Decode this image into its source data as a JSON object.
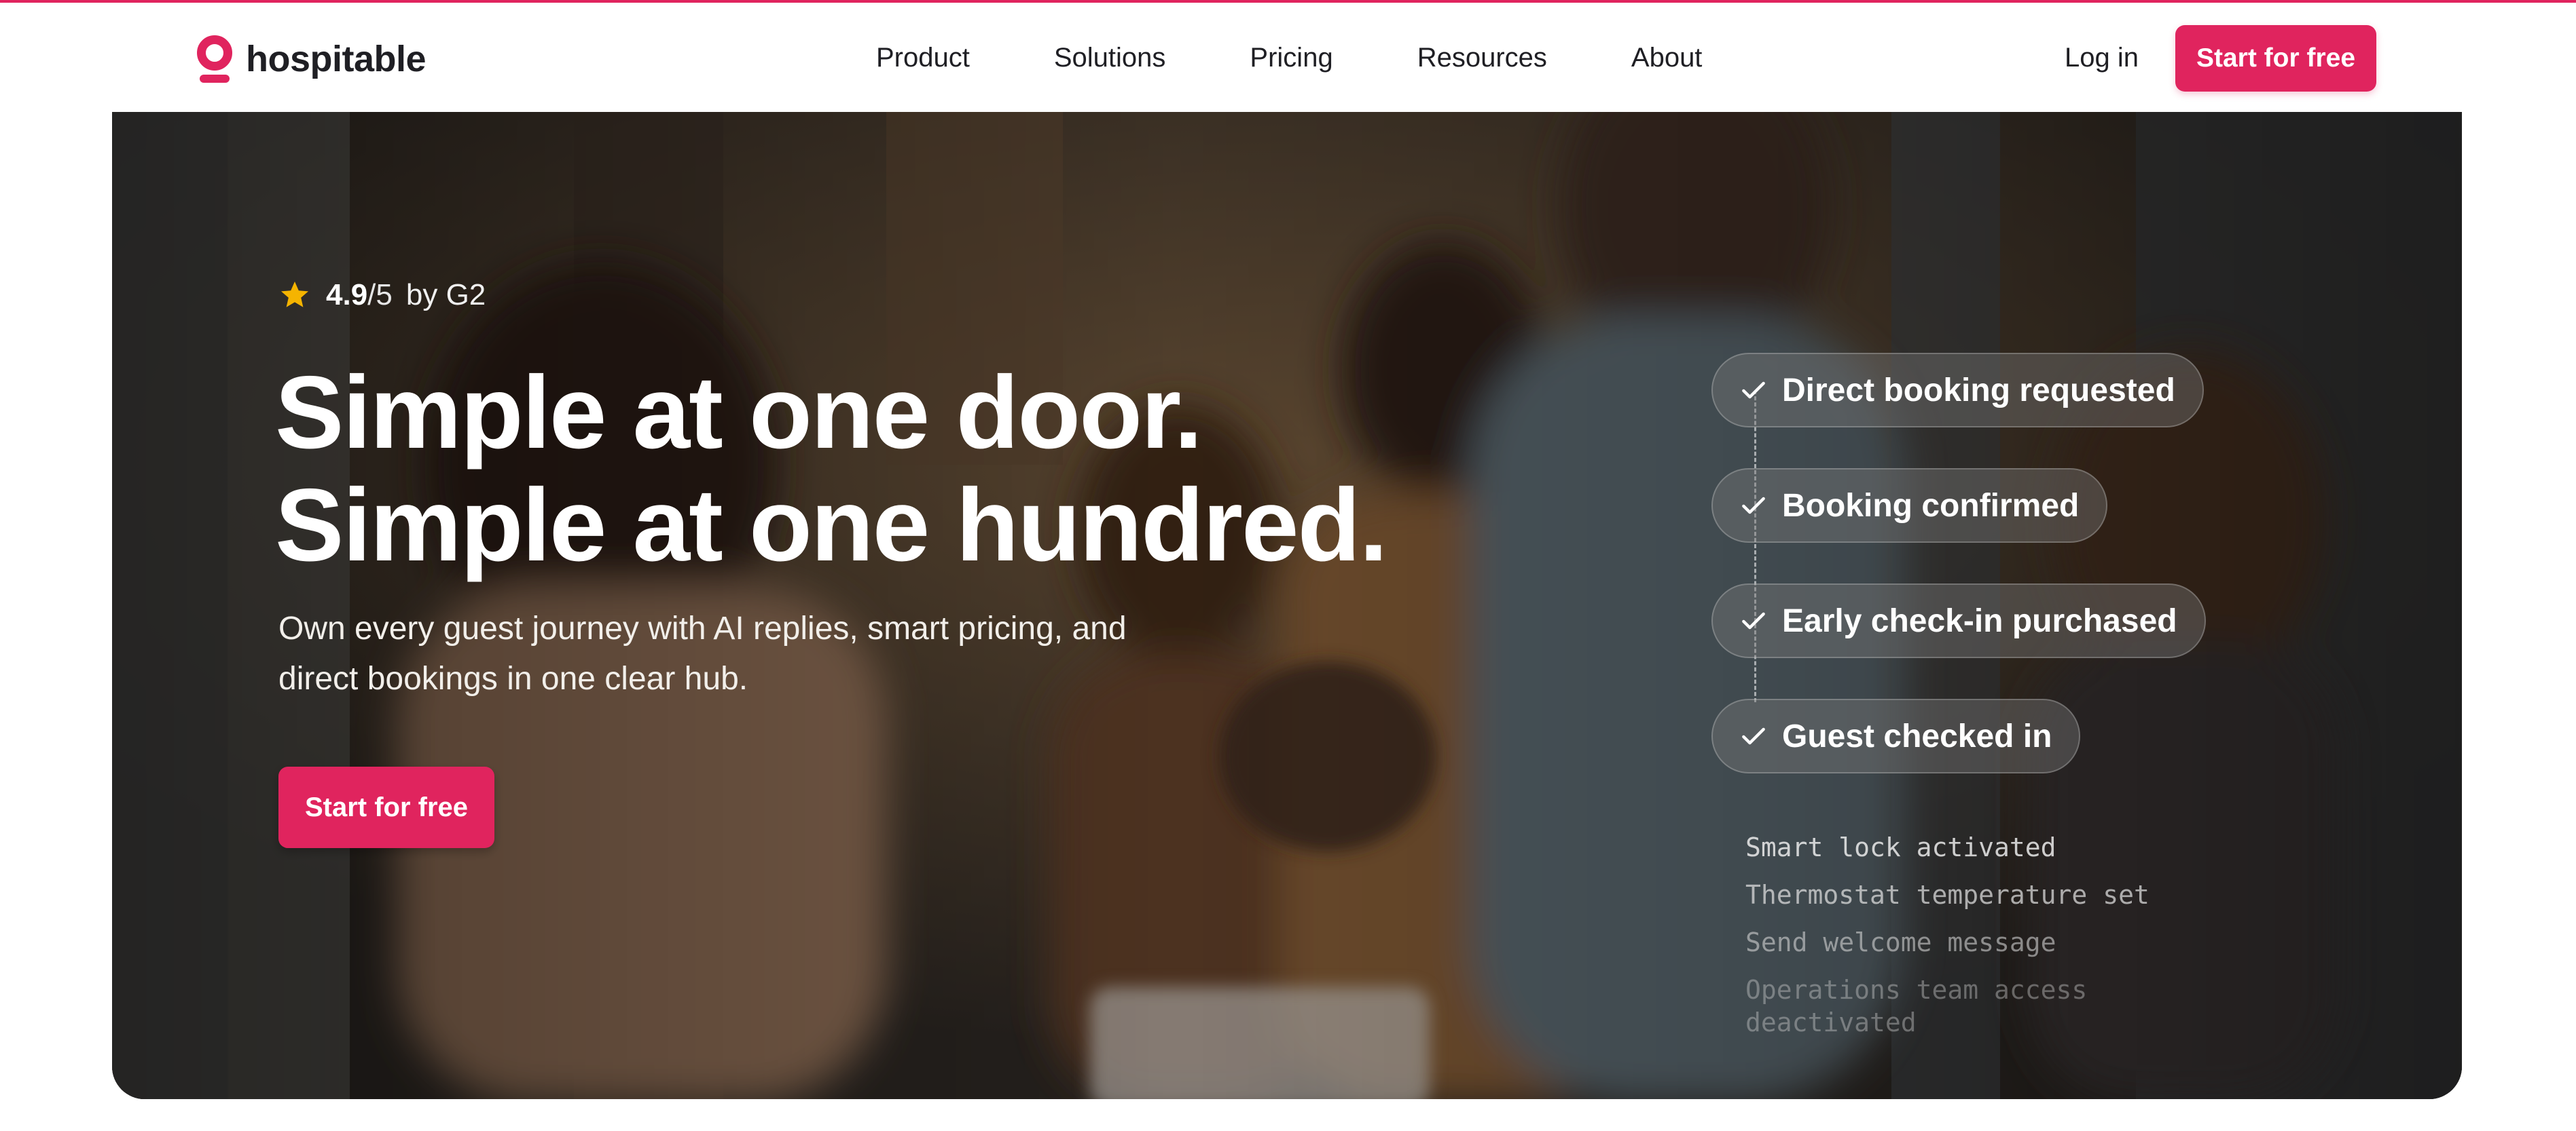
{
  "header": {
    "logo_text": "hospitable",
    "nav": [
      "Product",
      "Solutions",
      "Pricing",
      "Resources",
      "About"
    ],
    "login_label": "Log in",
    "cta_label": "Start for free"
  },
  "hero": {
    "rating": {
      "score": "4.9",
      "out_of": "/5",
      "by": "by G2"
    },
    "headline": [
      "Simple at one door.",
      "Simple at one hundred."
    ],
    "subtitle": "Own every guest journey with AI replies, smart pricing, and direct bookings in one clear hub.",
    "cta_label": "Start for free",
    "timeline": [
      "Direct booking requested",
      "Booking confirmed",
      "Early check-in purchased",
      "Guest checked in"
    ],
    "tasks": [
      "Smart lock activated",
      "Thermostat temperature set",
      "Send welcome message",
      "Operations team access deactivated"
    ]
  },
  "colors": {
    "brand": "#e0245e",
    "star": "#f5b400"
  }
}
